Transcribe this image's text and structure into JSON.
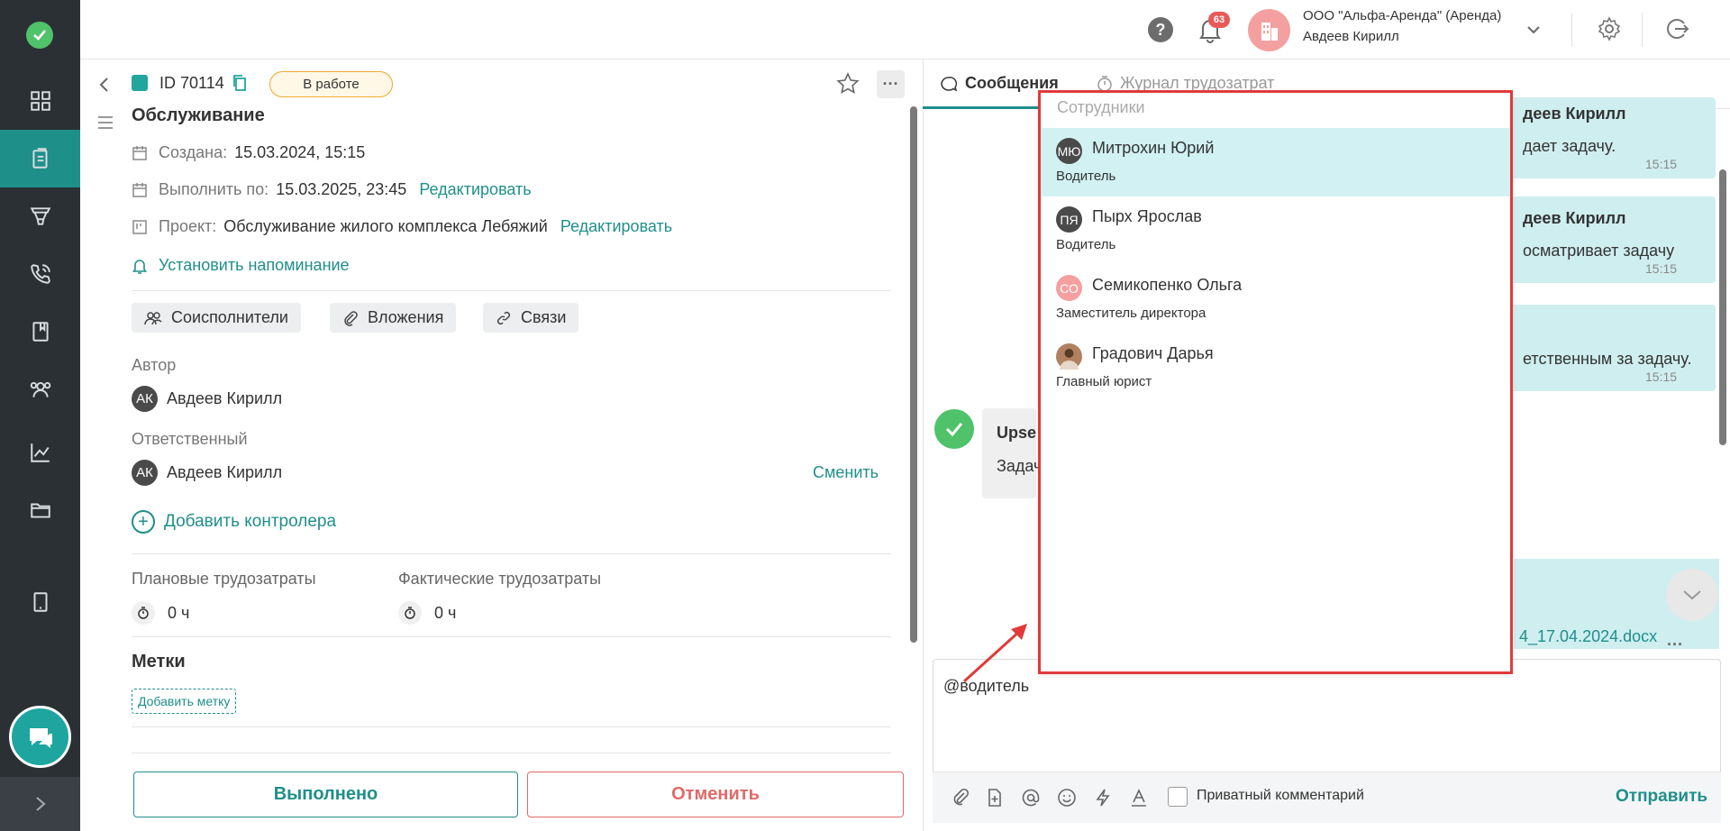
{
  "header": {
    "notifications_count": "63",
    "org_name": "ООО \"Альфа-Аренда\" (Аренда)",
    "user_name": "Авдеев Кирилл"
  },
  "task": {
    "id": "ID 70114",
    "status": "В работе",
    "title": "Обслуживание",
    "created_label": "Создана:",
    "created_value": "15.03.2024, 15:15",
    "due_label": "Выполнить по:",
    "due_value": "15.03.2025, 23:45",
    "edit_label": "Редактировать",
    "project_label": "Проект:",
    "project_value": "Обслуживание жилого комплекса Лебяжий",
    "reminder": "Установить напоминание",
    "chips": [
      "Соисполнители",
      "Вложения",
      "Связи"
    ],
    "author_label": "Автор",
    "author_initials": "АК",
    "author_name": "Авдеев Кирилл",
    "responsible_label": "Ответственный",
    "responsible_initials": "АК",
    "responsible_name": "Авдеев Кирилл",
    "change_label": "Сменить",
    "add_controller": "Добавить контролера",
    "planned_label": "Плановые трудозатраты",
    "planned_value": "0 ч",
    "actual_label": "Фактические трудозатраты",
    "actual_value": "0 ч",
    "tags_title": "Метки",
    "add_tag": "Добавить метку",
    "done_button": "Выполнено",
    "cancel_button": "Отменить"
  },
  "chat": {
    "tabs": [
      "Сообщения",
      "Журнал трудозатрат"
    ],
    "messages": [
      {
        "name": "деев Кирилл",
        "text": "дает задачу.",
        "time": "15:15"
      },
      {
        "name": "деев Кирилл",
        "text": "осматривает задачу",
        "time": "15:15"
      },
      {
        "name": "",
        "text": "етственным за задачу.",
        "time": "15:15"
      }
    ],
    "system_name": "Upse",
    "system_text": "Задач",
    "file_name": "4_17.04.2024.docx",
    "composer_text": "@водитель",
    "private_label": "Приватный комментарий",
    "send_label": "Отправить"
  },
  "mention_dropdown": {
    "title": "Сотрудники",
    "items": [
      {
        "initials": "МЮ",
        "name": "Митрохин Юрий",
        "role": "Водитель",
        "color": "#4a4a4a"
      },
      {
        "initials": "ПЯ",
        "name": "Пырх Ярослав",
        "role": "Водитель",
        "color": "#4a4a4a"
      },
      {
        "initials": "СО",
        "name": "Семикопенко Ольга",
        "role": "Заместитель директора",
        "color": "#f4a0a0"
      },
      {
        "initials": "",
        "name": "Градович Дарья",
        "role": "Главный юрист",
        "color": "#b08060"
      }
    ]
  },
  "colors": {
    "accent": "#1f8f8a",
    "danger": "#e06a6a",
    "highlight_border": "#e03a3a",
    "sidebar": "#2b3035"
  }
}
